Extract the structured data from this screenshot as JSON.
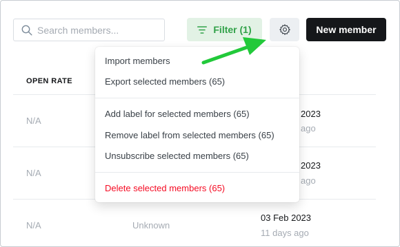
{
  "toolbar": {
    "search_placeholder": "Search members...",
    "filter_label": "Filter (1)",
    "new_member_label": "New member"
  },
  "table": {
    "column_open_rate": "OPEN RATE",
    "rows": [
      {
        "open_rate": "N/A",
        "date": "2023",
        "ago": "ago"
      },
      {
        "open_rate": "N/A",
        "date": "2023",
        "ago": "ago"
      },
      {
        "open_rate": "N/A",
        "status": "Unknown",
        "date": "03 Feb 2023",
        "ago": "11 days ago"
      }
    ]
  },
  "menu": {
    "import": "Import members",
    "export": "Export selected members (65)",
    "add_label": "Add label for selected members (65)",
    "remove_label": "Remove label from selected members (65)",
    "unsubscribe": "Unsubscribe selected members (65)",
    "delete": "Delete selected members (65)"
  },
  "colors": {
    "filter_green": "#30a148",
    "filter_bg": "#e2f2e5",
    "danger_red": "#f50b23",
    "arrow_green": "#22c93a",
    "primary_black": "#15171a"
  },
  "icons": {
    "search": "search-icon",
    "filter": "filter-icon",
    "settings": "gear-icon"
  }
}
